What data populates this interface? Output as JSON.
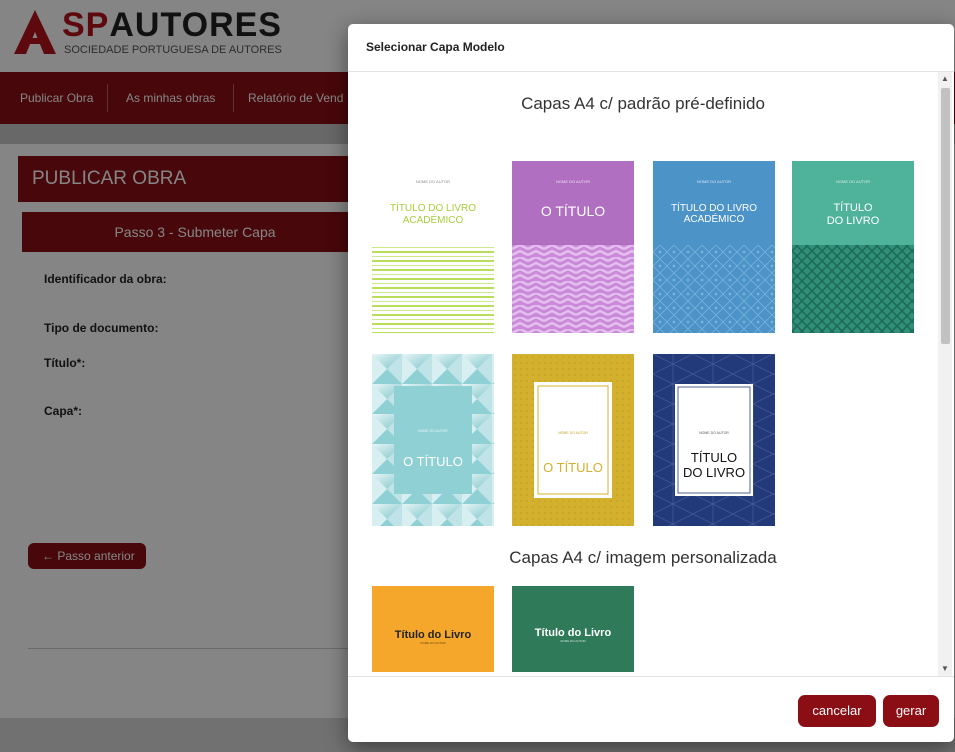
{
  "site": {
    "brand_prefix": "SP",
    "brand_main": "AUTORES",
    "brand_sub": "SOCIEDADE PORTUGUESA DE AUTORES"
  },
  "nav": {
    "items": [
      "Publicar Obra",
      "As minhas obras",
      "Relatório de Vend"
    ]
  },
  "page": {
    "panel_title": "PUBLICAR OBRA",
    "step_title": "Passo 3 - Submeter Capa",
    "fields": [
      "Identificador da obra:",
      "Tipo de documento:",
      "Título*:",
      "Capa*:"
    ],
    "prev_button": "← Passo anterior"
  },
  "modal": {
    "title": "Selecionar Capa Modelo",
    "section_predefined": "Capas A4 c/ padrão pré-definido",
    "section_custom": "Capas A4 c/ imagem personalizada",
    "cancel_button": "cancelar",
    "generate_button": "gerar"
  },
  "covers_predefined": [
    {
      "author": "NOME DO AUTOR",
      "title_line1": "TÍTULO DO LIVRO",
      "title_line2": "ACADÉMICO",
      "bg": "#ffffff",
      "title_color": "#a6cf3e",
      "pattern": "stripes"
    },
    {
      "author": "NOME DO AUTOR",
      "title_line1": "O TÍTULO",
      "title_line2": "",
      "bg": "#b06fc0",
      "title_color": "#ffffff",
      "pattern": "zigzag"
    },
    {
      "author": "NOME DO AUTOR",
      "title_line1": "TÍTULO DO LIVRO",
      "title_line2": "ACADÉMICO",
      "bg": "#4c93c8",
      "title_color": "#ffffff",
      "pattern": "lattice"
    },
    {
      "author": "NOME DO AUTOR",
      "title_line1": "TÍTULO",
      "title_line2": "DO LIVRO",
      "bg": "#4fb29a",
      "title_color": "#ffffff",
      "pattern": "cross-hatch"
    },
    {
      "author": "NOME DO AUTOR",
      "title_line1": "O TÍTULO",
      "title_line2": "",
      "bg": "#8fd0d4",
      "title_color": "#ffffff",
      "pattern": "geometric-frame"
    },
    {
      "author": "NOME DO AUTOR",
      "title_line1": "O TÍTULO",
      "title_line2": "",
      "bg": "#d4b02f",
      "title_color": "#d4b02f",
      "pattern": "framed"
    },
    {
      "author": "NOME DO AUTOR",
      "title_line1": "TÍTULO",
      "title_line2": "DO LIVRO",
      "bg": "#233a7a",
      "title_color": "#111111",
      "pattern": "framed-triangles"
    }
  ],
  "covers_custom": [
    {
      "title": "Título do Livro",
      "author": "NOME DO AUTOR",
      "bg": "#f4a72a",
      "title_color": "#222222"
    },
    {
      "title": "Título do Livro",
      "author": "NOME DO AUTOR",
      "bg": "#2f7a58",
      "title_color": "#ffffff"
    }
  ],
  "colors": {
    "brand_red": "#8b0e14",
    "logo_red": "#b5121b"
  }
}
